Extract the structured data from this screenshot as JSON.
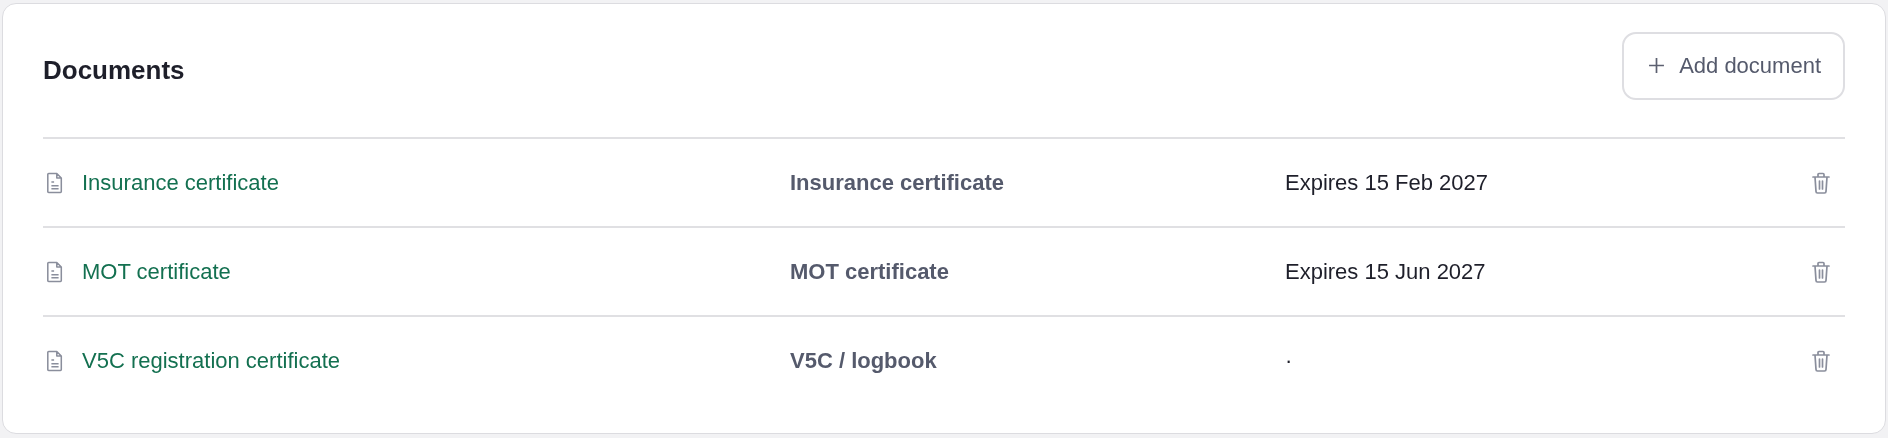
{
  "card": {
    "title": "Documents",
    "add_button": {
      "label": "Add document"
    }
  },
  "documents": [
    {
      "name": "Insurance certificate",
      "type": "Insurance certificate",
      "expiry": "Expires 15 Feb 2027"
    },
    {
      "name": "MOT certificate",
      "type": "MOT certificate",
      "expiry": "Expires 15 Jun 2027"
    },
    {
      "name": "V5C registration certificate",
      "type": "V5C / logbook",
      "expiry": "·"
    }
  ]
}
